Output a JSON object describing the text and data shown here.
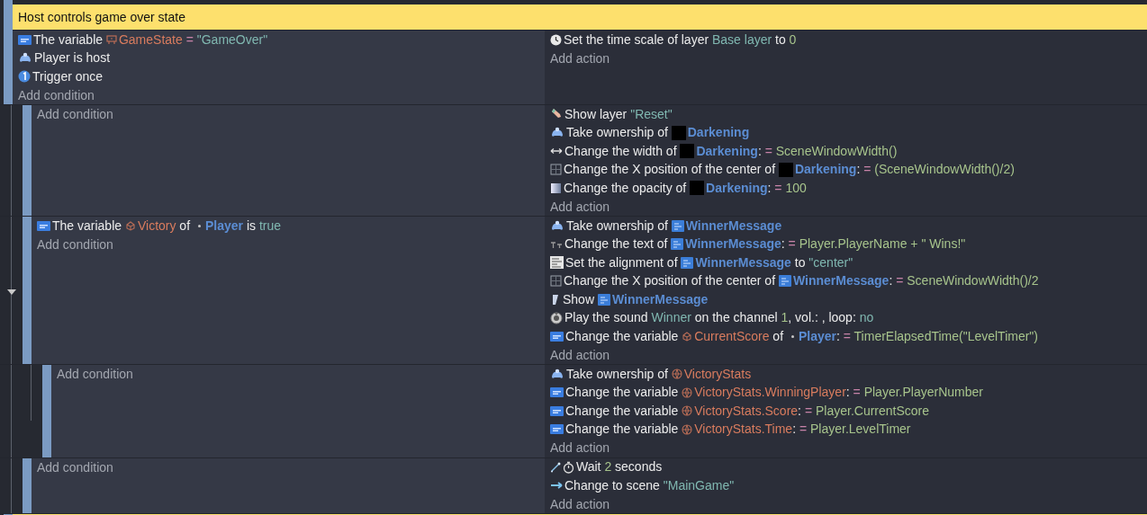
{
  "comment": {
    "text": "Host controls game over state"
  },
  "event": {
    "conditions": [
      {
        "kind": "variable",
        "segments": [
          {
            "kind": "plain",
            "text": "The variable "
          },
          {
            "kind": "scenevar",
            "text": "GameState"
          },
          {
            "kind": "operator",
            "text": " = "
          },
          {
            "kind": "value",
            "text": "\"GameOver\""
          }
        ]
      },
      {
        "kind": "multiplayer",
        "segments": [
          {
            "kind": "plain",
            "text": "Player is host"
          }
        ]
      },
      {
        "kind": "trigger",
        "segments": [
          {
            "kind": "plain",
            "text": "Trigger once"
          }
        ]
      }
    ],
    "add_condition": "Add condition",
    "actions": [
      {
        "kind": "clock",
        "segments": [
          {
            "kind": "plain",
            "text": "Set the time scale of layer "
          },
          {
            "kind": "value",
            "text": "Base layer"
          },
          {
            "kind": "plain",
            "text": " to "
          },
          {
            "kind": "expression",
            "text": "0"
          }
        ]
      }
    ],
    "add_action": "Add action",
    "children": [
      {
        "add_condition": "Add condition",
        "actions": [
          {
            "kind": "layer",
            "segments": [
              {
                "kind": "plain",
                "text": "Show layer "
              },
              {
                "kind": "value",
                "text": "\"Reset\""
              }
            ]
          },
          {
            "kind": "multiplayer",
            "segments": [
              {
                "kind": "plain",
                "text": "Take ownership of "
              },
              {
                "kind": "sprite",
                "text": "Darkening"
              }
            ]
          },
          {
            "kind": "width",
            "segments": [
              {
                "kind": "plain",
                "text": "Change the width of "
              },
              {
                "kind": "sprite",
                "text": "Darkening"
              },
              {
                "kind": "plain",
                "text": ": "
              },
              {
                "kind": "operator",
                "text": "= "
              },
              {
                "kind": "expression",
                "text": "SceneWindowWidth()"
              }
            ]
          },
          {
            "kind": "position",
            "segments": [
              {
                "kind": "plain",
                "text": "Change the X position of the center of "
              },
              {
                "kind": "sprite",
                "text": "Darkening"
              },
              {
                "kind": "plain",
                "text": ": "
              },
              {
                "kind": "operator",
                "text": "= "
              },
              {
                "kind": "expression",
                "text": "(SceneWindowWidth()/2)"
              }
            ]
          },
          {
            "kind": "opacity",
            "segments": [
              {
                "kind": "plain",
                "text": "Change the opacity of "
              },
              {
                "kind": "sprite",
                "text": "Darkening"
              },
              {
                "kind": "plain",
                "text": ": "
              },
              {
                "kind": "operator",
                "text": "= "
              },
              {
                "kind": "expression",
                "text": "100"
              }
            ]
          }
        ],
        "add_action": "Add action"
      },
      {
        "conditions": [
          {
            "kind": "variable",
            "segments": [
              {
                "kind": "plain",
                "text": "The variable "
              },
              {
                "kind": "objectvar",
                "text": "Victory"
              },
              {
                "kind": "plain",
                "text": " of "
              },
              {
                "kind": "player",
                "text": "Player"
              },
              {
                "kind": "plain",
                "text": " is "
              },
              {
                "kind": "value",
                "text": "true"
              }
            ]
          }
        ],
        "add_condition": "Add condition",
        "actions": [
          {
            "kind": "multiplayer",
            "segments": [
              {
                "kind": "plain",
                "text": "Take ownership of "
              },
              {
                "kind": "textobject",
                "text": "WinnerMessage"
              }
            ]
          },
          {
            "kind": "text",
            "segments": [
              {
                "kind": "plain",
                "text": "Change the text of "
              },
              {
                "kind": "textobject",
                "text": "WinnerMessage"
              },
              {
                "kind": "plain",
                "text": ": "
              },
              {
                "kind": "operator",
                "text": "= "
              },
              {
                "kind": "expression",
                "text": "Player.PlayerName + \" Wins!\""
              }
            ]
          },
          {
            "kind": "alignment",
            "segments": [
              {
                "kind": "plain",
                "text": "Set the alignment of "
              },
              {
                "kind": "textobject",
                "text": "WinnerMessage"
              },
              {
                "kind": "plain",
                "text": " to "
              },
              {
                "kind": "value",
                "text": "\"center\""
              }
            ]
          },
          {
            "kind": "position",
            "segments": [
              {
                "kind": "plain",
                "text": "Change the X position of the center of "
              },
              {
                "kind": "textobject",
                "text": "WinnerMessage"
              },
              {
                "kind": "plain",
                "text": ": "
              },
              {
                "kind": "operator",
                "text": "= "
              },
              {
                "kind": "expression",
                "text": "SceneWindowWidth()/2"
              }
            ]
          },
          {
            "kind": "show",
            "segments": [
              {
                "kind": "plain",
                "text": "Show "
              },
              {
                "kind": "textobject",
                "text": "WinnerMessage"
              }
            ]
          },
          {
            "kind": "sound",
            "segments": [
              {
                "kind": "plain",
                "text": "Play the sound "
              },
              {
                "kind": "value",
                "text": "Winner"
              },
              {
                "kind": "plain",
                "text": " on the channel "
              },
              {
                "kind": "expression",
                "text": "1"
              },
              {
                "kind": "plain",
                "text": ", vol.: , loop: "
              },
              {
                "kind": "value",
                "text": "no"
              }
            ]
          },
          {
            "kind": "variable",
            "segments": [
              {
                "kind": "plain",
                "text": "Change the variable "
              },
              {
                "kind": "objectvar",
                "text": "CurrentScore"
              },
              {
                "kind": "plain",
                "text": " of "
              },
              {
                "kind": "player",
                "text": "Player"
              },
              {
                "kind": "plain",
                "text": ": "
              },
              {
                "kind": "operator",
                "text": "= "
              },
              {
                "kind": "expression",
                "text": "TimerElapsedTime(\"LevelTimer\")"
              }
            ]
          }
        ],
        "add_action": "Add action",
        "children": [
          {
            "add_condition": "Add condition",
            "actions": [
              {
                "kind": "multiplayer",
                "segments": [
                  {
                    "kind": "plain",
                    "text": "Take ownership of "
                  },
                  {
                    "kind": "globalvar",
                    "text": "VictoryStats"
                  }
                ]
              },
              {
                "kind": "variable",
                "segments": [
                  {
                    "kind": "plain",
                    "text": "Change the variable "
                  },
                  {
                    "kind": "globalvar",
                    "text": "VictoryStats.WinningPlayer"
                  },
                  {
                    "kind": "plain",
                    "text": ": "
                  },
                  {
                    "kind": "operator",
                    "text": "= "
                  },
                  {
                    "kind": "expression",
                    "text": "Player.PlayerNumber"
                  }
                ]
              },
              {
                "kind": "variable",
                "segments": [
                  {
                    "kind": "plain",
                    "text": "Change the variable "
                  },
                  {
                    "kind": "globalvar",
                    "text": "VictoryStats.Score"
                  },
                  {
                    "kind": "plain",
                    "text": ": "
                  },
                  {
                    "kind": "operator",
                    "text": "= "
                  },
                  {
                    "kind": "expression",
                    "text": "Player.CurrentScore"
                  }
                ]
              },
              {
                "kind": "variable",
                "segments": [
                  {
                    "kind": "plain",
                    "text": "Change the variable "
                  },
                  {
                    "kind": "globalvar",
                    "text": "VictoryStats.Time"
                  },
                  {
                    "kind": "plain",
                    "text": ": "
                  },
                  {
                    "kind": "operator",
                    "text": "= "
                  },
                  {
                    "kind": "expression",
                    "text": "Player.LevelTimer"
                  }
                ]
              }
            ],
            "add_action": "Add action"
          }
        ]
      },
      {
        "add_condition": "Add condition",
        "actions": [
          {
            "kind": "wait",
            "segments": [
              {
                "kind": "plain",
                "text": "Wait "
              },
              {
                "kind": "expression",
                "text": "2"
              },
              {
                "kind": "plain",
                "text": " seconds"
              }
            ]
          },
          {
            "kind": "scene",
            "segments": [
              {
                "kind": "plain",
                "text": "Change to scene "
              },
              {
                "kind": "value",
                "text": "\"MainGame\""
              }
            ]
          }
        ],
        "add_action": "Add action"
      }
    ]
  }
}
